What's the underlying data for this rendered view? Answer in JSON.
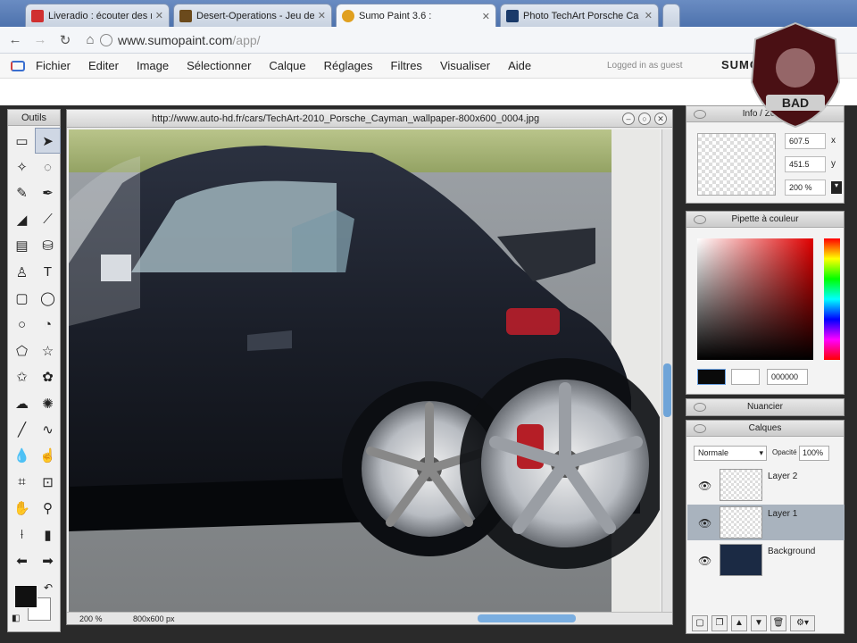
{
  "browser": {
    "tabs": [
      {
        "title": "Liveradio : écouter des radi",
        "favcolor": "#d03030",
        "active": false
      },
      {
        "title": "Desert-Operations - Jeu de",
        "favcolor": "#6b4a1c",
        "active": false
      },
      {
        "title": "Sumo Paint 3.6 :",
        "favcolor": "#e0a020",
        "active": true
      },
      {
        "title": "Photo TechArt Porsche Ca",
        "favcolor": "#1a3a6a",
        "active": false
      }
    ],
    "address": {
      "host": "www.sumopaint.com",
      "path": "/app/"
    }
  },
  "app_menu": {
    "items": [
      "Fichier",
      "Editer",
      "Image",
      "Sélectionner",
      "Calque",
      "Réglages",
      "Filtres",
      "Visualiser",
      "Aide"
    ],
    "status": "Logged in as guest",
    "brand": "SUMOPAINT.COM"
  },
  "tools_panel": {
    "title": "Outils",
    "tools": [
      {
        "icon": "▭",
        "name": "marquee-tool-icon"
      },
      {
        "icon": "➤",
        "name": "move-tool-icon"
      },
      {
        "icon": "✧",
        "name": "magic-wand-tool-icon"
      },
      {
        "icon": "◌",
        "name": "lasso-tool-icon"
      },
      {
        "icon": "✎",
        "name": "pencil-tool-icon"
      },
      {
        "icon": "✒",
        "name": "brush-tool-icon"
      },
      {
        "icon": "◢",
        "name": "eraser-tool-icon"
      },
      {
        "icon": "⟋",
        "name": "smudge-tool-icon"
      },
      {
        "icon": "▤",
        "name": "gradient-tool-icon"
      },
      {
        "icon": "⛁",
        "name": "fill-tool-icon"
      },
      {
        "icon": "♙",
        "name": "stamp-tool-icon"
      },
      {
        "icon": "T",
        "name": "text-tool-icon"
      },
      {
        "icon": "▢",
        "name": "rectangle-tool-icon"
      },
      {
        "icon": "◯",
        "name": "rounded-rect-tool-icon"
      },
      {
        "icon": "○",
        "name": "ellipse-tool-icon"
      },
      {
        "icon": "◔",
        "name": "pie-tool-icon"
      },
      {
        "icon": "⬠",
        "name": "polygon-tool-icon"
      },
      {
        "icon": "☆",
        "name": "star-tool-icon"
      },
      {
        "icon": "✩",
        "name": "star-outline-tool-icon"
      },
      {
        "icon": "✿",
        "name": "flower-tool-icon"
      },
      {
        "icon": "☁",
        "name": "cloud-tool-icon"
      },
      {
        "icon": "✺",
        "name": "burst-tool-icon"
      },
      {
        "icon": "╱",
        "name": "line-tool-icon"
      },
      {
        "icon": "∿",
        "name": "curve-tool-icon"
      },
      {
        "icon": "💧",
        "name": "blur-tool-icon"
      },
      {
        "icon": "☝",
        "name": "finger-tool-icon"
      },
      {
        "icon": "⌗",
        "name": "crop-tool-icon"
      },
      {
        "icon": "⊡",
        "name": "transform-tool-icon"
      },
      {
        "icon": "✋",
        "name": "hand-tool-icon"
      },
      {
        "icon": "⚲",
        "name": "zoom-tool-icon"
      },
      {
        "icon": "⟊",
        "name": "eyedropper-tool-icon"
      },
      {
        "icon": "▮",
        "name": "color-picker-tool-icon"
      },
      {
        "icon": "⬅",
        "name": "undo-arrow-icon"
      },
      {
        "icon": "➡",
        "name": "redo-arrow-icon"
      }
    ],
    "selected_index": 1,
    "fg_color": "#111111",
    "bg_color": "#ffffff"
  },
  "document": {
    "title": "http://www.auto-hd.fr/cars/TechArt-2010_Porsche_Cayman_wallpaper-800x600_0004.jpg",
    "zoom": "200 %",
    "size": "800x600 px"
  },
  "info_panel": {
    "title": "Info / Zoom",
    "x_value": "607.5",
    "x_unit": "x",
    "y_value": "451.5",
    "y_unit": "y",
    "zoom_value": "200 %"
  },
  "color_panel": {
    "title": "Pipette à couleur",
    "current_color": "#0a0a0a",
    "hex_value": "000000"
  },
  "swatches_panel": {
    "title": "Nuancier"
  },
  "layers_panel": {
    "title": "Calques",
    "blend_mode": "Normale",
    "opacity_label": "Opacité",
    "opacity_value": "100%",
    "layers": [
      {
        "name": "Layer 2",
        "selected": false
      },
      {
        "name": "Layer 1",
        "selected": true
      },
      {
        "name": "Background",
        "selected": false
      }
    ]
  },
  "watermark": {
    "text": "BAD"
  }
}
